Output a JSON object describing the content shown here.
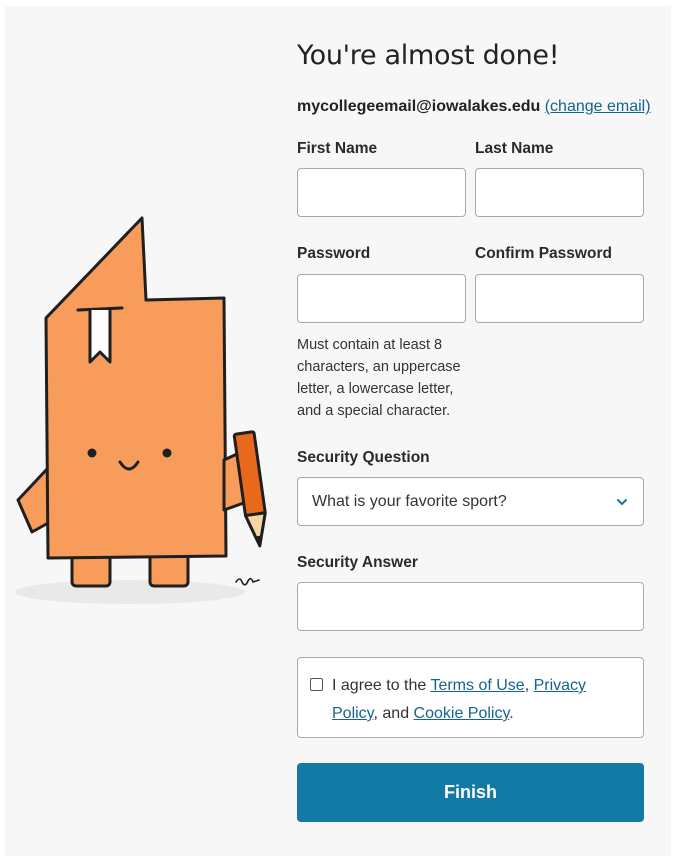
{
  "heading": "You're almost done!",
  "account": {
    "email": "mycollegeemail@iowalakes.edu",
    "change_email_label": "(change email)"
  },
  "fields": {
    "first_name": {
      "label": "First Name",
      "value": ""
    },
    "last_name": {
      "label": "Last Name",
      "value": ""
    },
    "password": {
      "label": "Password",
      "value": ""
    },
    "confirm_password": {
      "label": "Confirm Password",
      "value": ""
    },
    "password_hint": "Must contain at least 8 characters, an uppercase letter, a lowercase letter, and a special character.",
    "security_question": {
      "label": "Security Question",
      "selected": "What is your favorite sport?"
    },
    "security_answer": {
      "label": "Security Answer",
      "value": ""
    }
  },
  "agreement": {
    "checked": false,
    "prefix": "I agree to the ",
    "terms": "Terms of Use",
    "comma": ", ",
    "privacy": "Privacy Policy",
    "and": ", and ",
    "cookie": "Cookie Policy",
    "suffix": "."
  },
  "finish_label": "Finish",
  "colors": {
    "primary": "#137aa5",
    "link": "#14648f",
    "mascot_body": "#f89c5c",
    "mascot_outline": "#1f1f1f"
  },
  "icons": {
    "mascot": "document-mascot-illustration",
    "dropdown": "chevron-down-icon"
  }
}
